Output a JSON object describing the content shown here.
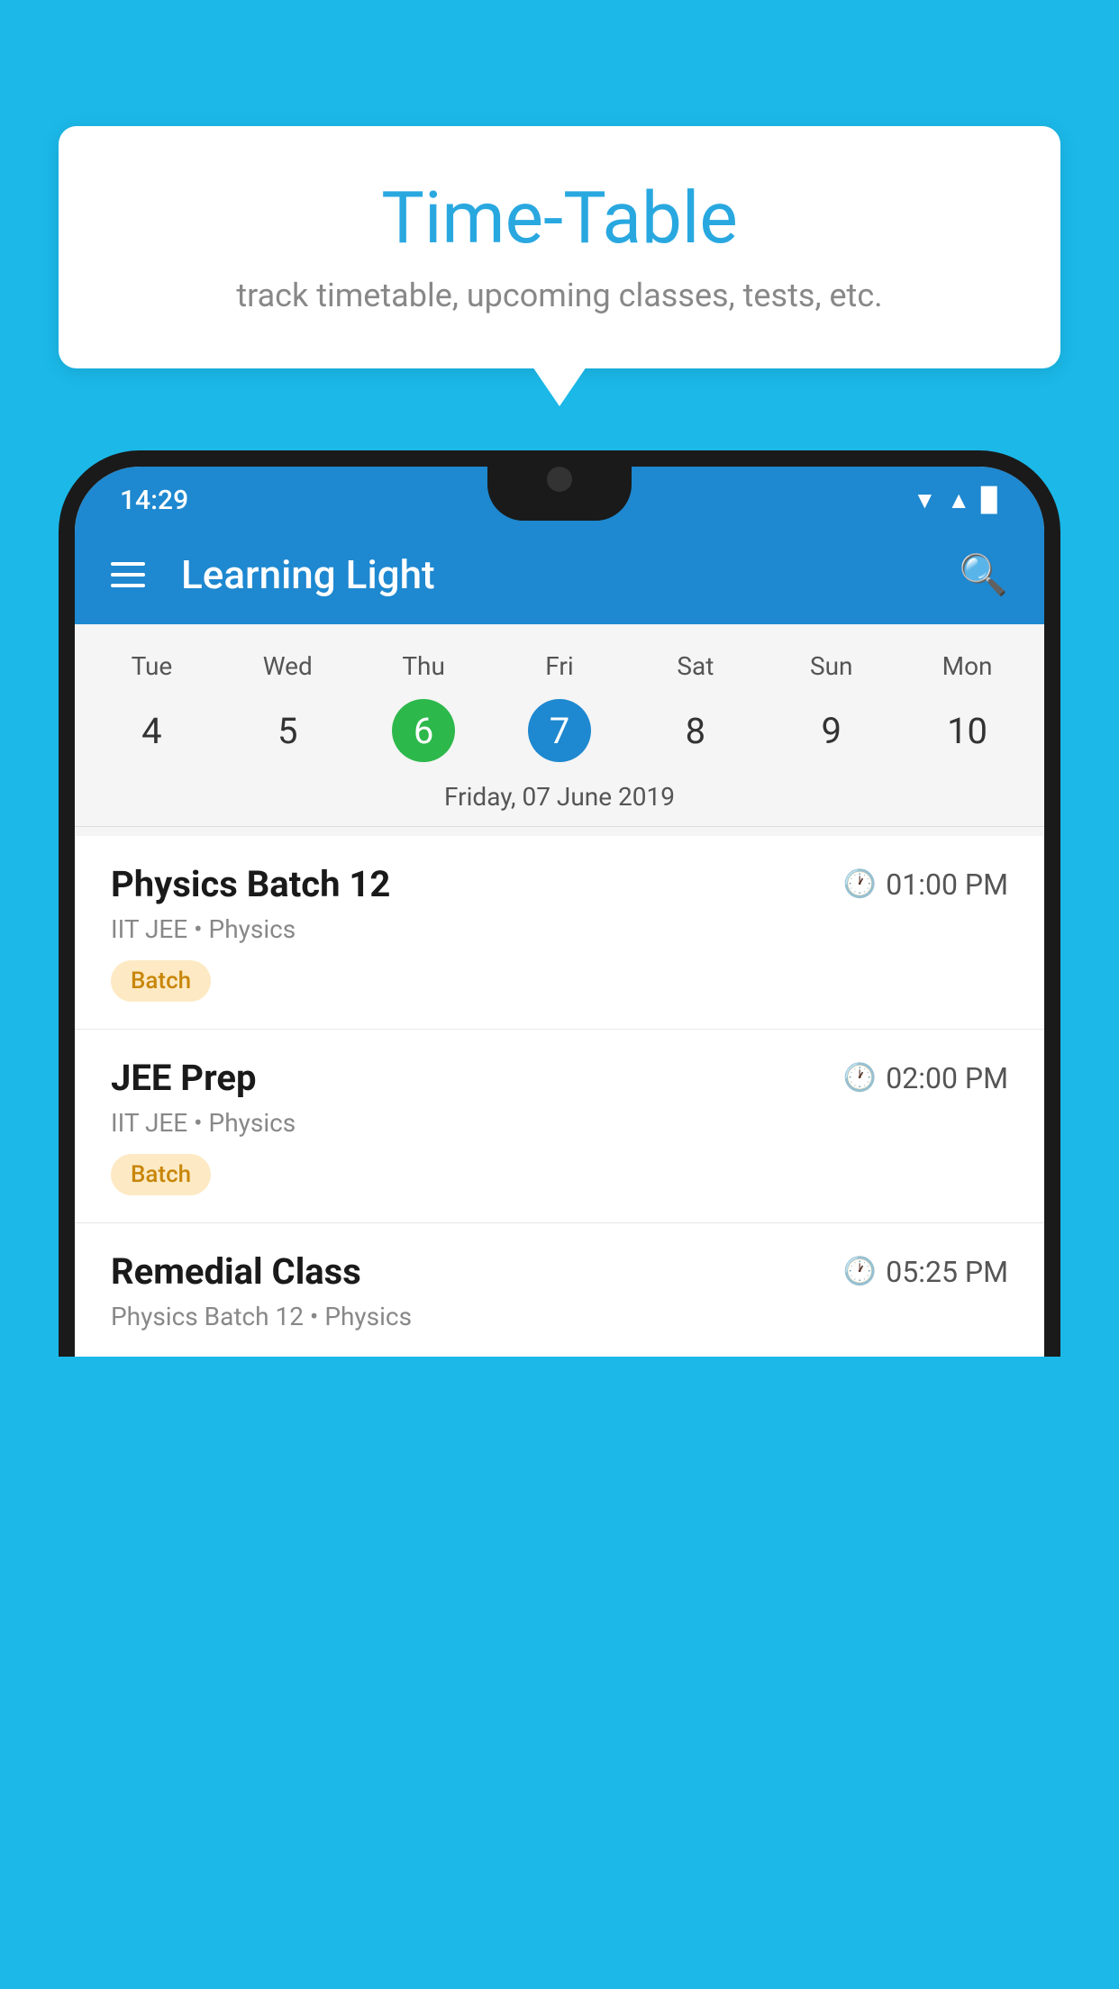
{
  "background_color": "#1bb8e8",
  "tooltip": {
    "title": "Time-Table",
    "subtitle": "track timetable, upcoming classes, tests, etc."
  },
  "status_bar": {
    "time": "14:29",
    "wifi": "▾",
    "signal": "▲",
    "battery": "▉"
  },
  "app_bar": {
    "title": "Learning Light",
    "menu_icon": "hamburger",
    "search_icon": "search"
  },
  "calendar": {
    "days": [
      "Tue",
      "Wed",
      "Thu",
      "Fri",
      "Sat",
      "Sun",
      "Mon"
    ],
    "dates": [
      "4",
      "5",
      "6",
      "7",
      "8",
      "9",
      "10"
    ],
    "today_index": 2,
    "selected_index": 3,
    "selected_date_label": "Friday, 07 June 2019"
  },
  "schedule_items": [
    {
      "title": "Physics Batch 12",
      "time": "01:00 PM",
      "meta": "IIT JEE • Physics",
      "badge": "Batch"
    },
    {
      "title": "JEE Prep",
      "time": "02:00 PM",
      "meta": "IIT JEE • Physics",
      "badge": "Batch"
    },
    {
      "title": "Remedial Class",
      "time": "05:25 PM",
      "meta": "Physics Batch 12 • Physics",
      "badge": null
    }
  ]
}
